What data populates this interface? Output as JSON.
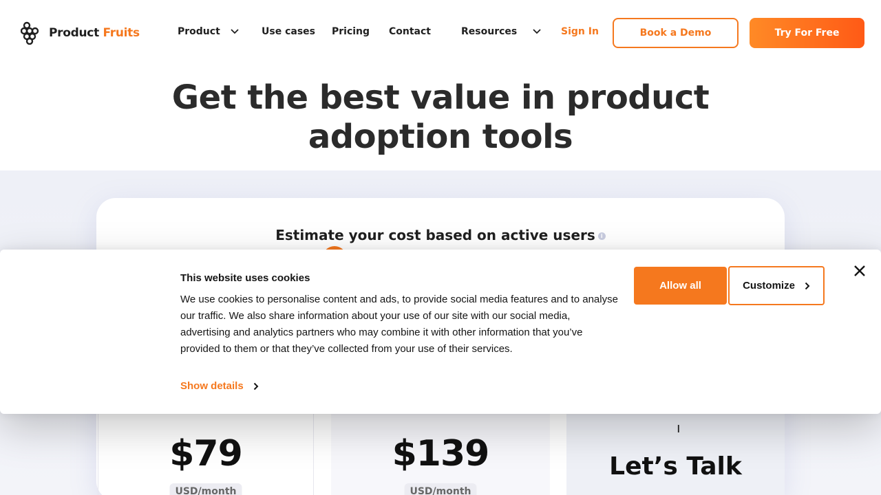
{
  "brand": {
    "name_part1": "Product",
    "name_part2": "Fruits",
    "accent": "#f5781e"
  },
  "nav": {
    "product": "Product",
    "use_cases": "Use cases",
    "pricing": "Pricing",
    "contact": "Contact",
    "resources": "Resources",
    "sign_in": "Sign In",
    "book_demo": "Book a Demo",
    "try_free": "Try For Free"
  },
  "hero": {
    "title": "Get the best value in product adoption tools"
  },
  "pricing": {
    "estimate_label": "Estimate your cost based on active users",
    "plans": [
      {
        "price": "$79",
        "unit": "USD/month"
      },
      {
        "price": "$139",
        "unit": "USD/month"
      },
      {
        "cta": "Let’s Talk"
      }
    ]
  },
  "cookie_banner": {
    "title": "This website uses cookies",
    "text": "We use cookies to personalise content and ads, to provide social media features and to analyse our traffic. We also share information about your use of our site with our social media, advertising and analytics partners who may combine it with other information that you’ve provided to them or that they’ve collected from your use of their services.",
    "show_details": "Show details",
    "allow_all": "Allow all",
    "customize": "Customize"
  },
  "icons": [
    "grapes-logo-icon",
    "chevron-down-icon",
    "info-icon",
    "chevron-right-icon",
    "close-icon"
  ]
}
